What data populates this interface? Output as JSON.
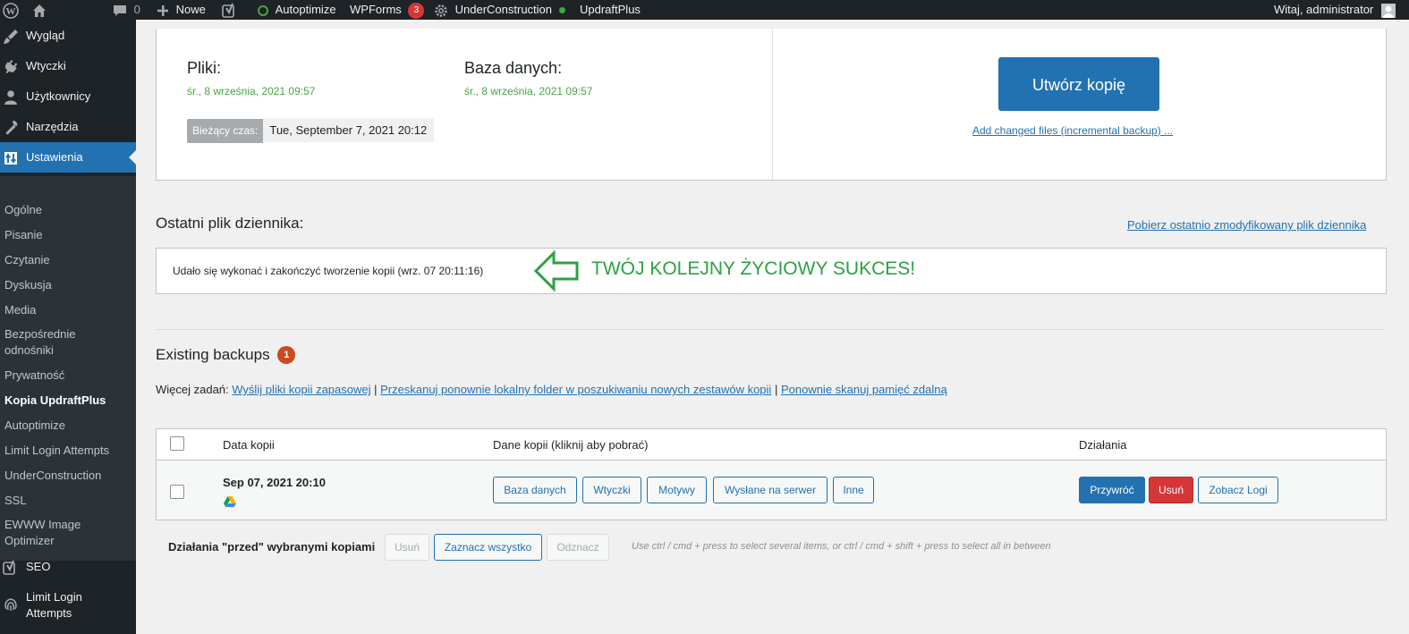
{
  "adminbar": {
    "comments_count": "0",
    "new_label": "Nowe",
    "autoptimize_label": "Autoptimize",
    "wpforms_label": "WPForms",
    "wpforms_count": "3",
    "underconstruction_label": "UnderConstruction",
    "updraftplus_label": "UpdraftPlus",
    "greeting": "Witaj, administrator",
    "status_color": "#46a546"
  },
  "sidebar": {
    "top_items": [
      {
        "label": "Wygląd",
        "icon": "paint-brush-icon"
      },
      {
        "label": "Wtyczki",
        "icon": "plugin-icon"
      },
      {
        "label": "Użytkownicy",
        "icon": "users-icon"
      },
      {
        "label": "Narzędzia",
        "icon": "tools-icon"
      },
      {
        "label": "Ustawienia",
        "icon": "settings-icon"
      }
    ],
    "submenu": [
      "Ogólne",
      "Pisanie",
      "Czytanie",
      "Dyskusja",
      "Media",
      "Bezpośrednie odnośniki",
      "Prywatność",
      "Kopia UpdraftPlus",
      "Autoptimize",
      "Limit Login Attempts",
      "UnderConstruction",
      "SSL",
      "EWWW Image Optimizer"
    ],
    "bottom_items": [
      {
        "label": "SEO",
        "icon": "yoast-icon"
      },
      {
        "label": "Limit Login Attempts",
        "icon": "fingerprint-icon"
      }
    ]
  },
  "status": {
    "files_label": "Pliki:",
    "files_date": "śr., 8 września, 2021 09:57",
    "db_label": "Baza danych:",
    "db_date": "śr., 8 września, 2021 09:57",
    "current_time_label": "Bieżący czas:",
    "current_time_value": "Tue, September 7, 2021 20:12",
    "create_backup_label": "Utwórz kopię",
    "incremental_link": "Add changed files (incremental backup) ..."
  },
  "log": {
    "title": "Ostatni plik dziennika:",
    "download_link": "Pobierz ostatnio zmodyfikowany plik dziennika",
    "message": "Udało się wykonać i zakończyć tworzenie kopii (wrz. 07 20:11:16)",
    "annotation": "TWÓJ KOLEJNY ŻYCIOWY SUKCES!",
    "annotation_color": "#2ea043"
  },
  "existing": {
    "title": "Existing backups",
    "count": "1",
    "more_tasks_label": "Więcej zadań:",
    "link1": "Wyślij pliki kopii zapasowej",
    "link2": "Przeskanuj ponownie lokalny folder w poszukiwaniu nowych zestawów kopii",
    "link3": "Ponownie skanuj pamięć zdalną",
    "sep": "|"
  },
  "table": {
    "col_date": "Data kopii",
    "col_data": "Dane kopii (kliknij aby pobrać)",
    "col_actions": "Działania",
    "row": {
      "date": "Sep 07, 2021 20:10",
      "data_buttons": [
        "Baza danych",
        "Wtyczki",
        "Motywy",
        "Wysłane na serwer",
        "Inne"
      ],
      "restore": "Przywróć",
      "delete": "Usuń",
      "view_log": "Zobacz Logi"
    }
  },
  "bulk": {
    "label": "Działania \"przed\" wybranymi kopiami",
    "delete": "Usuń",
    "select_all": "Zaznacz wszystko",
    "deselect": "Odznacz",
    "hint": "Use ctrl / cmd + press to select several items, or ctrl / cmd + shift + press to select all in between"
  }
}
